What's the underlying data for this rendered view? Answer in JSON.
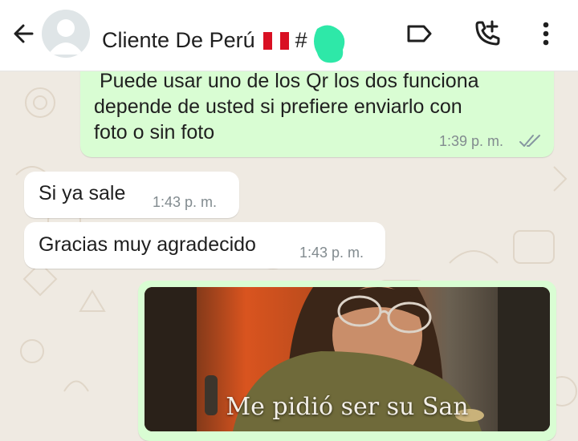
{
  "header": {
    "contact_name": "Cliente De Perú",
    "flag_icon": "peru-flag-icon",
    "hash": "#",
    "icons": [
      "back-arrow-icon",
      "avatar-placeholder-icon",
      "label-tag-icon",
      "add-call-icon",
      "more-vert-icon"
    ]
  },
  "messages": [
    {
      "direction": "outgoing",
      "lines": [
        "Puede usar uno de los Qr los dos funciona",
        "depende de usted si prefiere enviarlo con",
        "foto o sin foto"
      ],
      "time": "1:39 p. m.",
      "status": "read"
    },
    {
      "direction": "incoming",
      "text": "Si ya sale",
      "time": "1:43 p. m."
    },
    {
      "direction": "incoming",
      "text": "Gracias muy agradecido",
      "time": "1:43 p. m."
    },
    {
      "direction": "outgoing",
      "type": "image",
      "caption": "Me pidió ser su San"
    }
  ],
  "colors": {
    "outgoing_bubble": "#d9fdd3",
    "incoming_bubble": "#ffffff",
    "chat_background": "#efeae2",
    "read_ticks": "#8696a0",
    "redaction_blot": "#2ee8a8"
  }
}
